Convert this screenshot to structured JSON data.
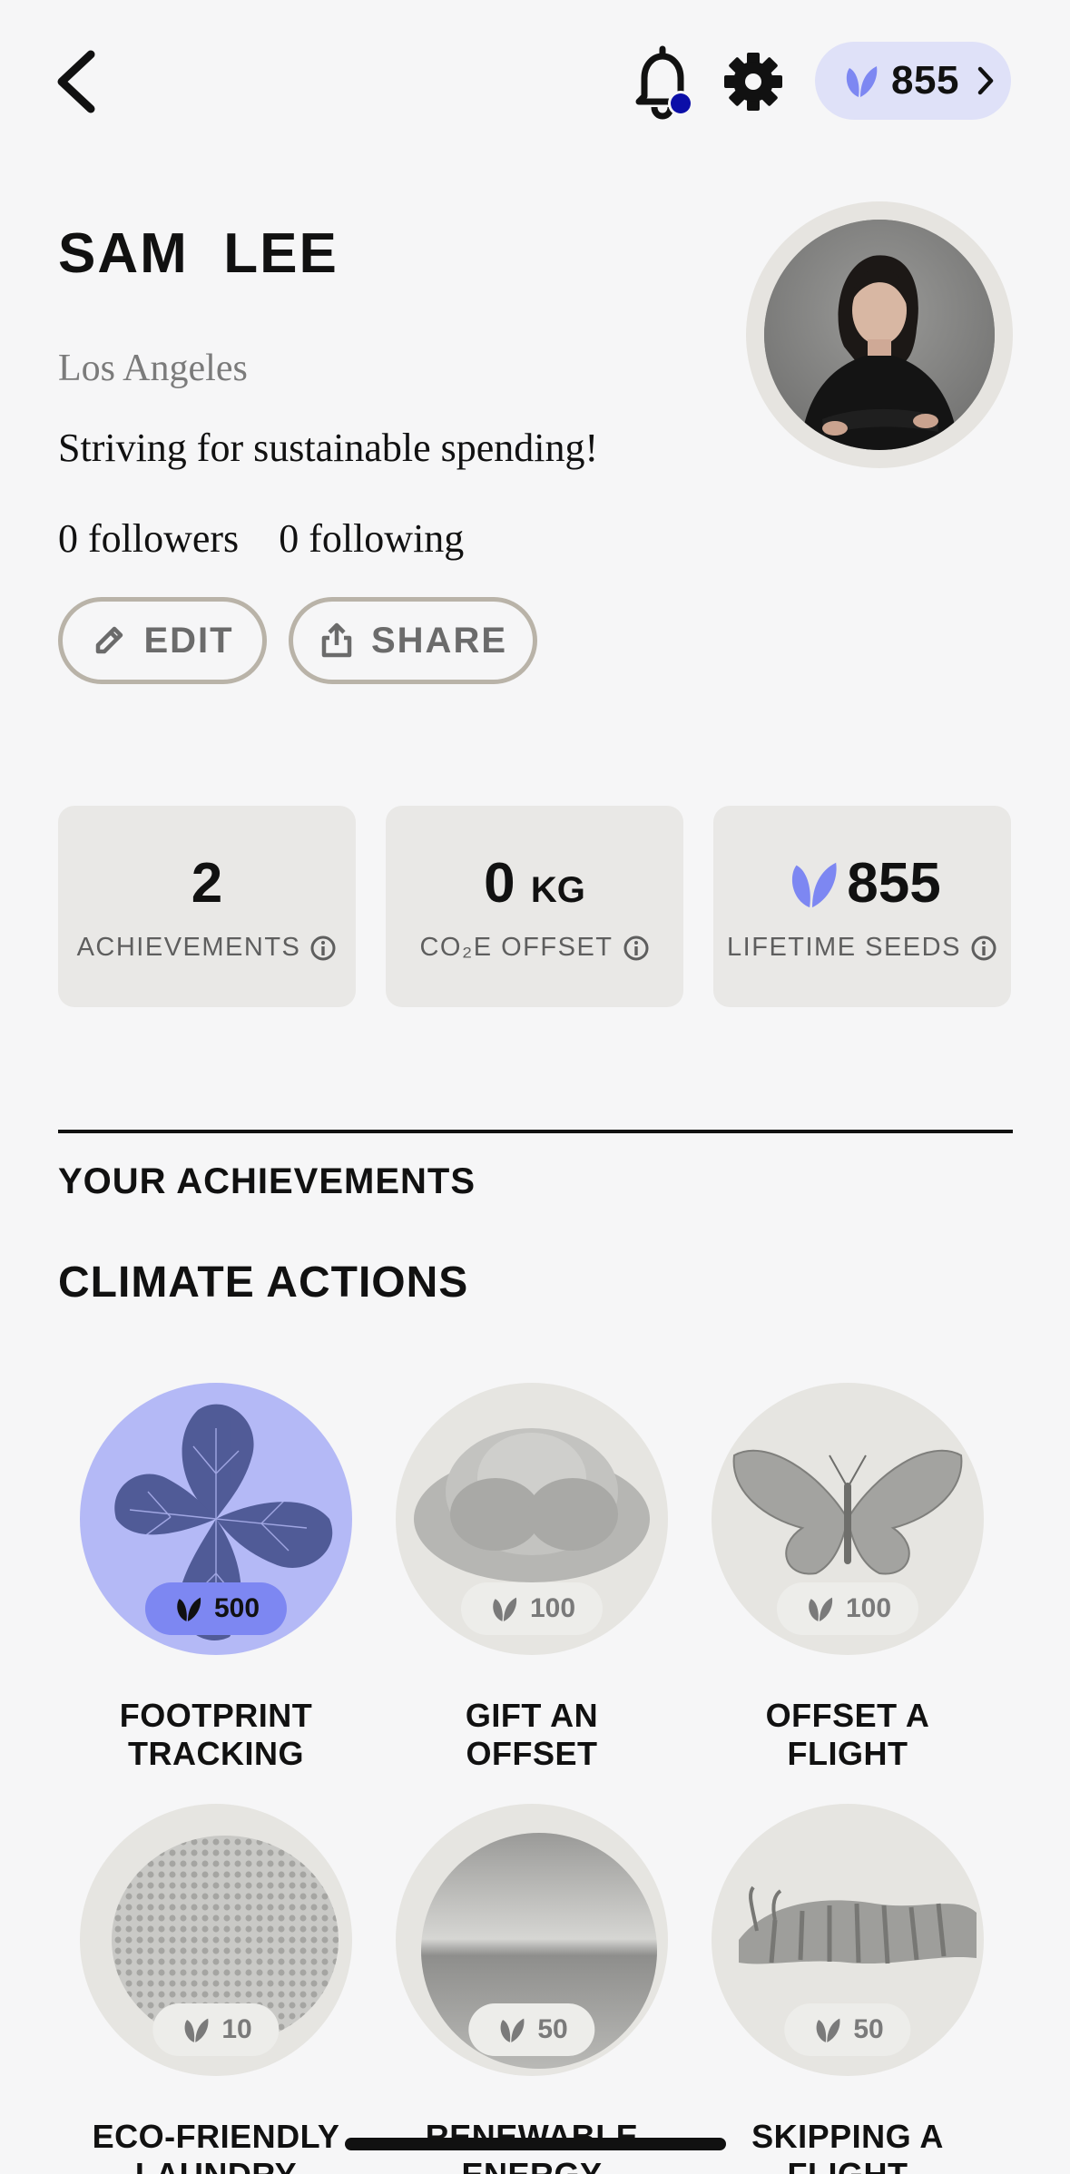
{
  "topbar": {
    "seeds_count": "855",
    "notification_dot_color": "#0b0ea8"
  },
  "profile": {
    "name": "SAM  LEE",
    "location": "Los Angeles",
    "bio": "Striving for sustainable spending!",
    "followers": "0 followers",
    "following": "0 following",
    "edit_label": "EDIT",
    "share_label": "SHARE"
  },
  "stats": {
    "achievements_value": "2",
    "achievements_label": "ACHIEVEMENTS",
    "co2_value": "0",
    "co2_unit": "KG",
    "co2_label": "CO₂E OFFSET",
    "seeds_value": "855",
    "seeds_label": "LIFETIME SEEDS"
  },
  "section": {
    "your_achievements": "YOUR ACHIEVEMENTS",
    "climate_actions": "CLIMATE ACTIONS"
  },
  "achievements": [
    {
      "title": "FOOTPRINT TRACKING",
      "seeds": "500",
      "active": true
    },
    {
      "title": "GIFT AN OFFSET",
      "seeds": "100",
      "active": false
    },
    {
      "title": "OFFSET A FLIGHT",
      "seeds": "100",
      "active": false
    },
    {
      "title": "ECO-FRIENDLY LAUNDRY",
      "seeds": "10",
      "active": false
    },
    {
      "title": "RENEWABLE ENERGY",
      "seeds": "50",
      "active": false
    },
    {
      "title": "SKIPPING A FLIGHT",
      "seeds": "50",
      "active": false
    }
  ],
  "colors": {
    "accent": "#7d87f2",
    "accent_light": "#b4b9f6",
    "pill": "#dfe1f8"
  }
}
